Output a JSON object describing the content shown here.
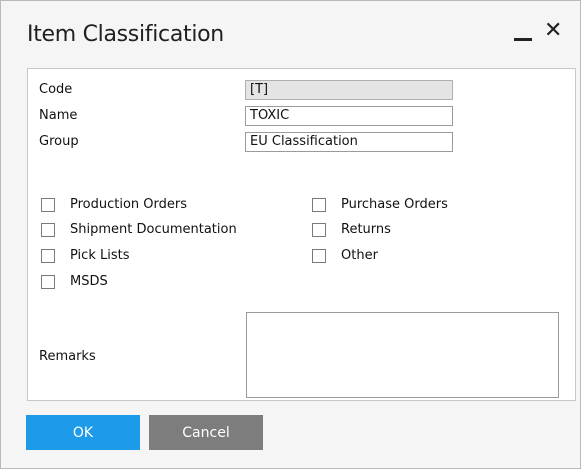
{
  "window": {
    "title": "Item Classification",
    "minimize_icon": "minimize-icon",
    "close_icon": "close-icon"
  },
  "form": {
    "code_label": "Code",
    "code_value": "[T]",
    "name_label": "Name",
    "name_value": "TOXIC",
    "group_label": "Group",
    "group_value": "EU Classification",
    "link_arrow_icon": "link-arrow-icon",
    "link_arrow_color": "#f5a623"
  },
  "checkboxes": {
    "left": [
      {
        "label": "Production Orders",
        "checked": false
      },
      {
        "label": "Shipment Documentation",
        "checked": false
      },
      {
        "label": "Pick Lists",
        "checked": false
      },
      {
        "label": "MSDS",
        "checked": false
      }
    ],
    "right": [
      {
        "label": "Purchase Orders",
        "checked": false
      },
      {
        "label": "Returns",
        "checked": false
      },
      {
        "label": "Other",
        "checked": false
      }
    ]
  },
  "remarks": {
    "label": "Remarks",
    "value": ""
  },
  "buttons": {
    "ok_label": "OK",
    "cancel_label": "Cancel",
    "ok_color": "#1d9ae8",
    "cancel_color": "#7d7d7d"
  }
}
